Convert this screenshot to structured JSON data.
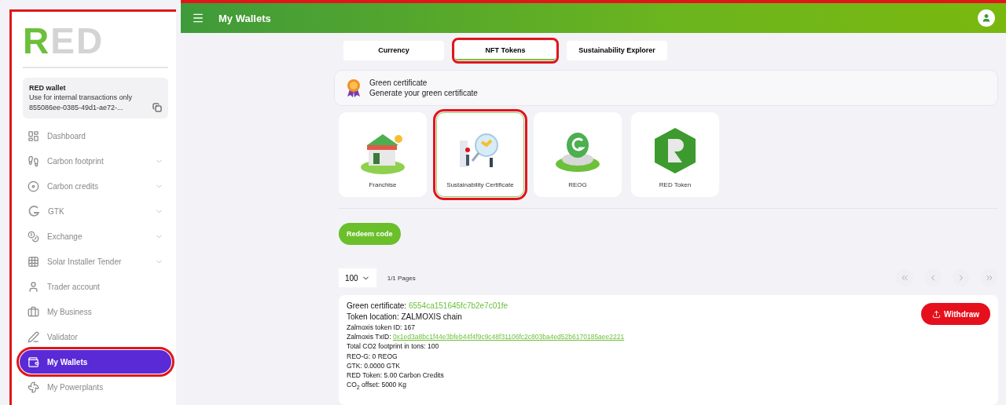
{
  "sidebar": {
    "highlighted": true,
    "logo": "RED",
    "wallet": {
      "title": "RED wallet",
      "subtitle": "Use for internal transactions only",
      "address": "855086ee-0385-49d1-ae72-..."
    },
    "items": [
      {
        "label": "Dashboard",
        "expandable": false,
        "selected": false,
        "highlighted": false
      },
      {
        "label": "Carbon footprint",
        "expandable": true,
        "selected": false,
        "highlighted": false
      },
      {
        "label": "Carbon credits",
        "expandable": true,
        "selected": false,
        "highlighted": false
      },
      {
        "label": "GTK",
        "expandable": true,
        "selected": false,
        "highlighted": false
      },
      {
        "label": "Exchange",
        "expandable": true,
        "selected": false,
        "highlighted": false
      },
      {
        "label": "Solar Installer Tender",
        "expandable": true,
        "selected": false,
        "highlighted": false
      },
      {
        "label": "Trader account",
        "expandable": false,
        "selected": false,
        "highlighted": false
      },
      {
        "label": "My Business",
        "expandable": false,
        "selected": false,
        "highlighted": false
      },
      {
        "label": "Validator",
        "expandable": false,
        "selected": false,
        "highlighted": false
      },
      {
        "label": "My Wallets",
        "expandable": false,
        "selected": true,
        "highlighted": true
      },
      {
        "label": "My Powerplants",
        "expandable": false,
        "selected": false,
        "highlighted": false
      }
    ]
  },
  "header": {
    "title": "My Wallets"
  },
  "tabs": [
    {
      "label": "Currency",
      "selected": false,
      "highlighted": false
    },
    {
      "label": "NFT Tokens",
      "selected": true,
      "highlighted": true
    },
    {
      "label": "Sustainability Explorer",
      "selected": false,
      "highlighted": false
    }
  ],
  "banner": {
    "title": "Green certificate",
    "subtitle": "Generate your green certificate"
  },
  "cards": [
    {
      "label": "Franchise",
      "kind": "shop",
      "selected": false,
      "highlighted": false
    },
    {
      "label": "Sustainability Certificate",
      "kind": "magnifier",
      "selected": true,
      "highlighted": true
    },
    {
      "label": "REOG",
      "kind": "coin",
      "selected": false,
      "highlighted": false
    },
    {
      "label": "RED Token",
      "kind": "hexagon",
      "selected": false,
      "highlighted": false
    }
  ],
  "redeem_button": "Redeem code",
  "pagination": {
    "page_size": "100",
    "pages": "1/1 Pages"
  },
  "record": {
    "withdraw_button": "Withdraw",
    "lines": [
      {
        "kind": "large",
        "label": "Green certificate: ",
        "value": "6554ca151645fc7b2e7c01fe"
      },
      {
        "kind": "large",
        "label": "Token location: ZALMOXIS chain"
      },
      {
        "kind": "plain",
        "label": "Zalmoxis token ID: 167"
      },
      {
        "kind": "plain",
        "label": "Zalmoxis TxID: ",
        "value": "0x1ed3a8bc1f44e3bfeb44f4f9c9c48f31106fc2c803ba4ed52b6170185aee2221",
        "link": true
      },
      {
        "kind": "plain",
        "label": "Total CO2 footprint in tons: 100"
      },
      {
        "kind": "plain",
        "label": "REO-G: 0 REOG"
      },
      {
        "kind": "plain",
        "label": "GTK: 0.0000 GTK"
      },
      {
        "kind": "plain",
        "label": "RED Token: 5.00 Carbon Credits"
      },
      {
        "kind": "plain",
        "label": "CO$_{2}$ offset: 5000 Kg"
      }
    ]
  }
}
